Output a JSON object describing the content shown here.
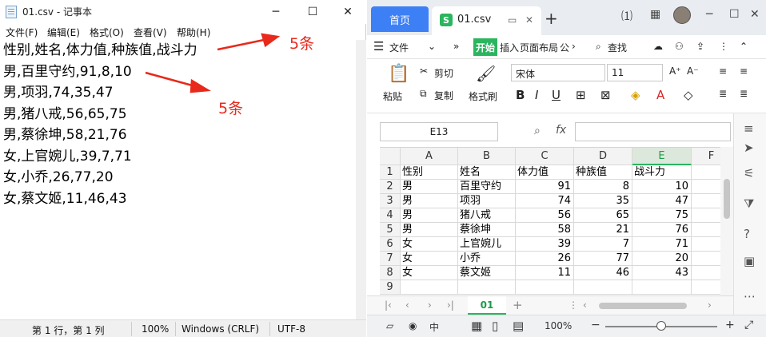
{
  "notepad": {
    "title": "01.csv - 记事本",
    "menu": [
      "文件(F)",
      "编辑(E)",
      "格式(O)",
      "查看(V)",
      "帮助(H)"
    ],
    "lines": [
      "性别,姓名,体力值,种族值,战斗力",
      "男,百里守约,91,8,10",
      "男,项羽,74,35,47",
      "男,猪八戒,56,65,75",
      "男,蔡徐坤,58,21,76",
      "女,上官婉儿,39,7,71",
      "女,小乔,26,77,20",
      "女,蔡文姬,11,46,43"
    ],
    "status": {
      "position": "第 1 行，第 1 列",
      "zoom": "100%",
      "eol": "Windows (CRLF)",
      "encoding": "UTF-8"
    }
  },
  "annotations": {
    "top": "5条",
    "middle": "5条",
    "color": "#e8291c"
  },
  "wps": {
    "home_tab": "首页",
    "file_tab": "01.csv",
    "file_tab_icon": "S",
    "menu": {
      "file": "文件",
      "start": "开始",
      "insert": "插入",
      "layout": "页面布局",
      "formula": "公",
      "search": "查找"
    },
    "ribbon": {
      "paste": "粘贴",
      "cut": "剪切",
      "copy": "复制",
      "format_painter": "格式刷",
      "font": "宋体",
      "size": "11"
    },
    "name_box": "E13",
    "fx": "fx",
    "columns": [
      "A",
      "B",
      "C",
      "D",
      "E",
      "F"
    ],
    "rows": [
      {
        "n": "1",
        "cells": [
          "性别",
          "姓名",
          "体力值",
          "种族值",
          "战斗力"
        ]
      },
      {
        "n": "2",
        "cells": [
          "男",
          "百里守约",
          "91",
          "8",
          "10"
        ]
      },
      {
        "n": "3",
        "cells": [
          "男",
          "项羽",
          "74",
          "35",
          "47"
        ]
      },
      {
        "n": "4",
        "cells": [
          "男",
          "猪八戒",
          "56",
          "65",
          "75"
        ]
      },
      {
        "n": "5",
        "cells": [
          "男",
          "蔡徐坤",
          "58",
          "21",
          "76"
        ]
      },
      {
        "n": "6",
        "cells": [
          "女",
          "上官婉儿",
          "39",
          "7",
          "71"
        ]
      },
      {
        "n": "7",
        "cells": [
          "女",
          "小乔",
          "26",
          "77",
          "20"
        ]
      },
      {
        "n": "8",
        "cells": [
          "女",
          "蔡文姬",
          "11",
          "46",
          "43"
        ]
      },
      {
        "n": "9",
        "cells": [
          "",
          "",
          "",
          "",
          ""
        ]
      }
    ],
    "sheet_tab": "01",
    "zoom": "100%",
    "accent": "#2ab55e",
    "home_color": "#3d7ff5"
  }
}
